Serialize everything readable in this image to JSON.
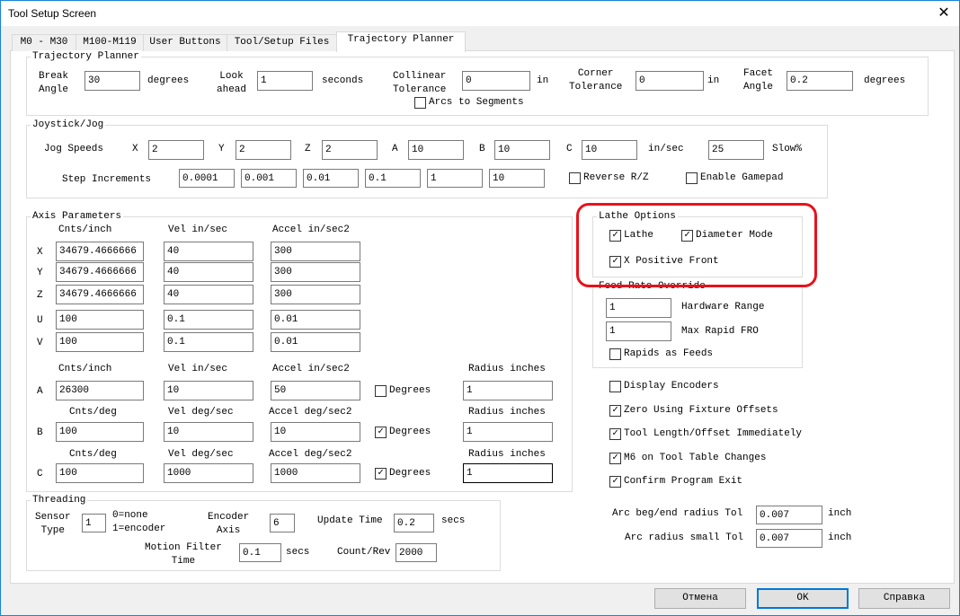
{
  "window": {
    "title": "Tool Setup Screen",
    "close_icon": "close-icon"
  },
  "tabs": [
    {
      "label": "M0 - M30"
    },
    {
      "label": "M100-M119"
    },
    {
      "label": "User Buttons"
    },
    {
      "label": "Tool/Setup Files"
    },
    {
      "label": "Trajectory Planner",
      "active": true
    }
  ],
  "trajectory": {
    "title": "Trajectory Planner",
    "break_angle_label": "Break\nAngle",
    "break_angle": "30",
    "break_angle_unit": "degrees",
    "look_ahead_label": "Look\nahead",
    "look_ahead": "1",
    "look_ahead_unit": "seconds",
    "collinear_label": "Collinear\nTolerance",
    "collinear": "0",
    "collinear_unit": "in",
    "corner_label": "Corner\nTolerance",
    "corner": "0",
    "corner_unit": "in",
    "facet_label": "Facet\nAngle",
    "facet": "0.2",
    "facet_unit": "degrees",
    "arcs_label": "Arcs to Segments",
    "arcs_checked": false
  },
  "jog": {
    "title": "Joystick/Jog",
    "speeds_label": "Jog Speeds",
    "x_label": "X",
    "x": "2",
    "y_label": "Y",
    "y": "2",
    "z_label": "Z",
    "z": "2",
    "a_label": "A",
    "a": "10",
    "b_label": "B",
    "b": "10",
    "c_label": "C",
    "c": "10",
    "speed_unit": "in/sec",
    "slow": "25",
    "slow_label": "Slow%",
    "step_label": "Step Increments",
    "steps": [
      "0.0001",
      "0.001",
      "0.01",
      "0.1",
      "1",
      "10"
    ],
    "reverse_label": "Reverse R/Z",
    "reverse_checked": false,
    "gamepad_label": "Enable Gamepad",
    "gamepad_checked": false
  },
  "axis": {
    "title": "Axis Parameters",
    "headers_linear": [
      "Cnts/inch",
      "Vel in/sec",
      "Accel in/sec2"
    ],
    "headers_a": [
      "Cnts/inch",
      "Vel in/sec",
      "Accel in/sec2",
      "Radius inches"
    ],
    "headers_rot": [
      "Cnts/deg",
      "Vel deg/sec",
      "Accel deg/sec2",
      "Radius inches"
    ],
    "rows": [
      {
        "axis": "X",
        "cnts": "34679.4666666",
        "vel": "40",
        "accel": "300"
      },
      {
        "axis": "Y",
        "cnts": "34679.4666666",
        "vel": "40",
        "accel": "300"
      },
      {
        "axis": "Z",
        "cnts": "34679.4666666",
        "vel": "40",
        "accel": "300"
      },
      {
        "axis": "U",
        "cnts": "100",
        "vel": "0.1",
        "accel": "0.01"
      },
      {
        "axis": "V",
        "cnts": "100",
        "vel": "0.1",
        "accel": "0.01"
      },
      {
        "axis": "A",
        "cnts": "26300",
        "vel": "10",
        "accel": "50",
        "degrees": false,
        "radius": "1"
      },
      {
        "axis": "B",
        "cnts": "100",
        "vel": "10",
        "accel": "10",
        "degrees": true,
        "radius": "1"
      },
      {
        "axis": "C",
        "cnts": "100",
        "vel": "1000",
        "accel": "1000",
        "degrees": true,
        "radius": "1"
      }
    ],
    "degrees_label": "Degrees"
  },
  "lathe": {
    "title": "Lathe Options",
    "lathe_label": "Lathe",
    "lathe_checked": true,
    "diameter_label": "Diameter Mode",
    "diameter_checked": true,
    "xpos_label": "X Positive Front",
    "xpos_checked": true,
    "highlight_color": "#e8121b"
  },
  "fro": {
    "title": "Feed Rate Override",
    "hardware": "1",
    "hardware_label": "Hardware Range",
    "max_rapid": "1",
    "max_rapid_label": "Max Rapid FRO",
    "rapids_label": "Rapids as Feeds",
    "rapids_checked": false
  },
  "options": [
    {
      "label": "Display Encoders",
      "checked": false
    },
    {
      "label": "Zero Using Fixture Offsets",
      "checked": true
    },
    {
      "label": "Tool Length/Offset Immediately",
      "checked": true
    },
    {
      "label": "M6 on Tool Table Changes",
      "checked": true
    },
    {
      "label": "Confirm Program Exit",
      "checked": true
    }
  ],
  "arc": {
    "begend_label": "Arc beg/end radius Tol",
    "begend": "0.007",
    "small_label": "Arc radius small Tol",
    "small": "0.007",
    "unit": "inch"
  },
  "threading": {
    "title": "Threading",
    "sensor_label": "Sensor\nType",
    "sensor": "1",
    "sensor_legend": "0=none\n1=encoder",
    "encoder_label": "Encoder\nAxis",
    "encoder": "6",
    "update_label": "Update Time",
    "update": "0.2",
    "secs": "secs",
    "filter_label": "Motion Filter\nTime",
    "filter": "0.1",
    "count_label": "Count/Rev",
    "count": "2000"
  },
  "buttons": {
    "cancel": "Отмена",
    "ok": "OK",
    "help": "Справка"
  }
}
